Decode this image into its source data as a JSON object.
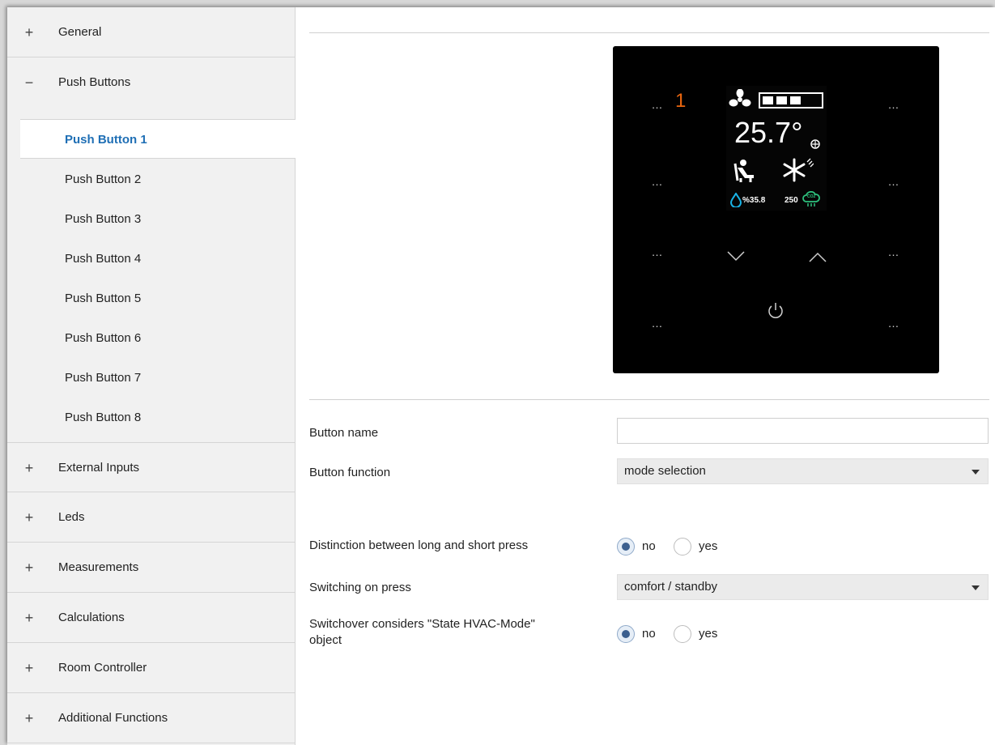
{
  "sidebar": {
    "items_top": [
      {
        "symbol": "+",
        "label": "General"
      },
      {
        "symbol": "−",
        "label": "Push Buttons"
      }
    ],
    "subitems": [
      {
        "label": "Push Button 1",
        "active": true
      },
      {
        "label": "Push Button 2"
      },
      {
        "label": "Push Button 3"
      },
      {
        "label": "Push Button 4"
      },
      {
        "label": "Push Button 5"
      },
      {
        "label": "Push Button 6"
      },
      {
        "label": "Push Button 7"
      },
      {
        "label": "Push Button 8"
      }
    ],
    "items_bottom": [
      {
        "symbol": "+",
        "label": "External Inputs"
      },
      {
        "symbol": "+",
        "label": "Leds"
      },
      {
        "symbol": "+",
        "label": "Measurements"
      },
      {
        "symbol": "+",
        "label": "Calculations"
      },
      {
        "symbol": "+",
        "label": "Room Controller"
      },
      {
        "symbol": "+",
        "label": "Additional Functions"
      }
    ]
  },
  "device": {
    "button_dots": "…",
    "selected_number": "1",
    "temperature": "25.7°",
    "humidity": "%35.8",
    "co2": "250",
    "co2_label": "CO2",
    "icons": [
      "fan-icon",
      "fan-level-bars-icon",
      "person-seated-icon",
      "snowflake-icon",
      "water-drop-icon",
      "cloud-co2-icon",
      "chevron-down-icon",
      "chevron-up-icon",
      "power-icon"
    ],
    "accent_color": "#e8650f",
    "cyan_color": "#19b3e6",
    "green_color": "#2ec27e"
  },
  "form": {
    "button_name": {
      "label": "Button name",
      "value": ""
    },
    "button_function": {
      "label": "Button function",
      "value": "mode selection"
    },
    "distinction": {
      "label": "Distinction between long and short press",
      "options": [
        "no",
        "yes"
      ],
      "selected": "no"
    },
    "switching_on_press": {
      "label": "Switching on press",
      "value": "comfort / standby"
    },
    "switchover": {
      "label_line1": "Switchover considers \"State HVAC-Mode\"",
      "label_line2": "object",
      "options": [
        "no",
        "yes"
      ],
      "selected": "no"
    }
  }
}
